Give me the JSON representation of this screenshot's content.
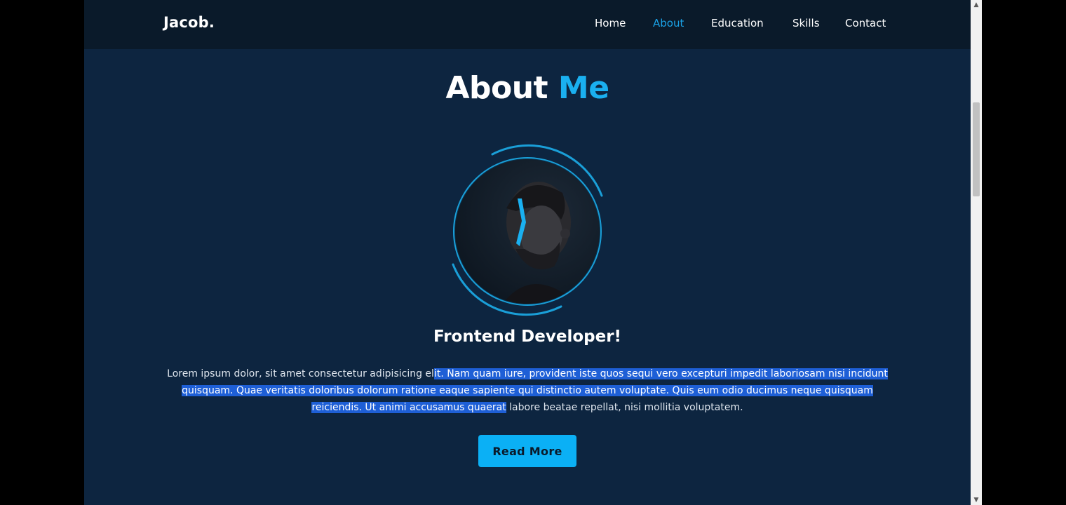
{
  "nav": {
    "logo": "Jacob.",
    "links": [
      {
        "label": "Home",
        "active": false
      },
      {
        "label": "About",
        "active": true
      },
      {
        "label": "Education",
        "active": false
      },
      {
        "label": "Skills",
        "active": false
      },
      {
        "label": "Contact",
        "active": false
      }
    ]
  },
  "about": {
    "title_main": "About",
    "title_accent": "Me",
    "photo_icon": "profile-photo",
    "subtitle": "Frontend Developer!",
    "text_before_selection": "Lorem ipsum dolor, sit amet consectetur adipisicing el",
    "text_selected": "it. Nam quam iure, provident iste quos sequi vero excepturi impedit laboriosam nisi incidunt quisquam. Quae veritatis doloribus dolorum ratione eaque sapiente qui distinctio autem voluptate. Quis eum odio ducimus neque quisquam reiciendis. Ut animi accusamus quaerat",
    "text_after_selection": " labore beatae repellat, nisi mollitia voluptatem.",
    "button_label": "Read More"
  },
  "colors": {
    "background": "#0d2540",
    "navbar": "#0a1a2a",
    "accent": "#1ab0f0",
    "selection": "#1e5fd6",
    "button": "#0bb0f5"
  }
}
